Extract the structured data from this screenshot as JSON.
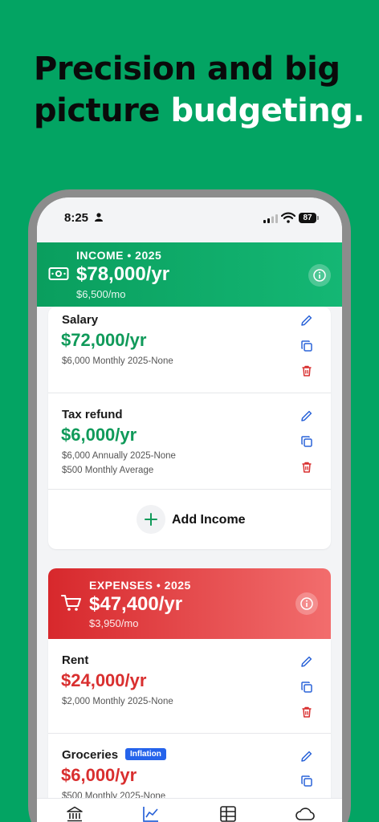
{
  "headline": {
    "line1": "Precision and big",
    "line2_dark": "picture ",
    "line2_accent": "budgeting."
  },
  "status": {
    "time": "8:25",
    "battery": "87"
  },
  "income": {
    "label": "INCOME • 2025",
    "amount": "$78,000/yr",
    "monthly": "$6,500/mo",
    "items": [
      {
        "name": "Salary",
        "amount": "$72,000/yr",
        "detail1": "$6,000 Monthly   2025-None",
        "detail2": ""
      },
      {
        "name": "Tax refund",
        "amount": "$6,000/yr",
        "detail1": "$6,000 Annually   2025-None",
        "detail2": "$500 Monthly Average"
      }
    ],
    "add_label": "Add Income"
  },
  "expenses": {
    "label": "EXPENSES • 2025",
    "amount": "$47,400/yr",
    "monthly": "$3,950/mo",
    "items": [
      {
        "name": "Rent",
        "amount": "$24,000/yr",
        "detail1": "$2,000 Monthly   2025-None"
      },
      {
        "name": "Groceries",
        "badge": "Inflation",
        "amount": "$6,000/yr",
        "detail1": "$500 Monthly   2025-None"
      }
    ]
  },
  "colors": {
    "brand_green": "#03a463",
    "income_green": "#109a5a",
    "expense_red": "#d92f2f",
    "badge_blue": "#2563eb"
  },
  "tabs": [
    "bank-icon",
    "chart-icon",
    "table-icon",
    "cloud-icon"
  ]
}
